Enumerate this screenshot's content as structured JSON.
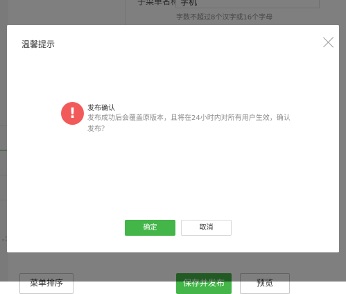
{
  "background": {
    "field_label": "子菜单名称",
    "field_value": "字机",
    "field_hint": "字数不超过8个汉字或16个字母",
    "left_edge_text": "，：",
    "buttons": {
      "sort": "菜单排序",
      "save_publish": "保存并发布",
      "preview": "预览"
    }
  },
  "dialog": {
    "title": "温馨提示",
    "close_icon": "close-icon",
    "warning_icon": "exclamation-icon",
    "warning_glyph": "!",
    "message_title": "发布确认",
    "message_body": "发布成功后会覆盖原版本，且将在24小时内对所有用户生效，确认发布？",
    "confirm_label": "确定",
    "cancel_label": "取消"
  },
  "colors": {
    "primary_green": "#44b549",
    "warning_red": "#f25a5a",
    "mask": "rgba(0,0,0,0.5)"
  }
}
